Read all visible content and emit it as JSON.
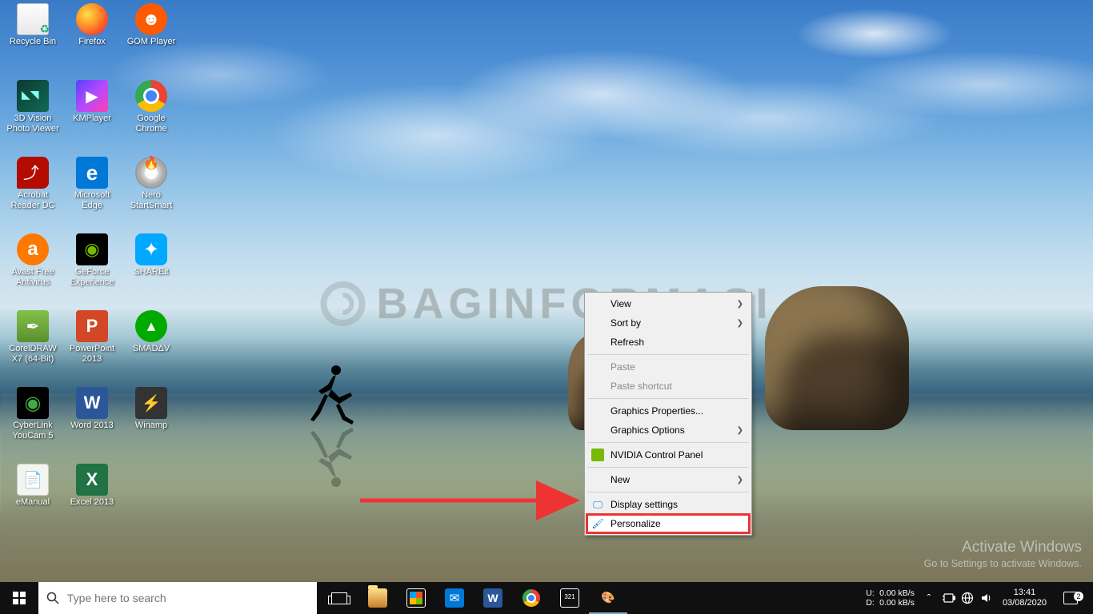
{
  "desktop_icons": [
    {
      "row": 0,
      "col": 0,
      "label": "Recycle Bin",
      "cls": "ic-recycle"
    },
    {
      "row": 0,
      "col": 1,
      "label": "Firefox",
      "cls": "ic-firefox"
    },
    {
      "row": 0,
      "col": 2,
      "label": "GOM Player",
      "cls": "ic-gom",
      "glyph": "☻"
    },
    {
      "row": 1,
      "col": 0,
      "label": "3D Vision Photo Viewer",
      "cls": "ic-3dvision"
    },
    {
      "row": 1,
      "col": 1,
      "label": "KMPlayer",
      "cls": "ic-kmp"
    },
    {
      "row": 1,
      "col": 2,
      "label": "Google Chrome",
      "cls": "ic-chrome"
    },
    {
      "row": 2,
      "col": 0,
      "label": "Acrobat Reader DC",
      "cls": "ic-acrobat"
    },
    {
      "row": 2,
      "col": 1,
      "label": "Microsoft Edge",
      "cls": "ic-edge"
    },
    {
      "row": 2,
      "col": 2,
      "label": "Nero StartSmart",
      "cls": "ic-nero"
    },
    {
      "row": 3,
      "col": 0,
      "label": "Avast Free Antivirus",
      "cls": "ic-avast"
    },
    {
      "row": 3,
      "col": 1,
      "label": "GeForce Experience",
      "cls": "ic-geforce"
    },
    {
      "row": 3,
      "col": 2,
      "label": "SHAREit",
      "cls": "ic-shareit"
    },
    {
      "row": 4,
      "col": 0,
      "label": "CorelDRAW X7 (64-Bit)",
      "cls": "ic-corel"
    },
    {
      "row": 4,
      "col": 1,
      "label": "PowerPoint 2013",
      "cls": "ic-ppt"
    },
    {
      "row": 4,
      "col": 2,
      "label": "SMADΔV",
      "cls": "ic-smadav"
    },
    {
      "row": 5,
      "col": 0,
      "label": "CyberLink YouCam 5",
      "cls": "ic-youcam"
    },
    {
      "row": 5,
      "col": 1,
      "label": "Word 2013",
      "cls": "ic-word"
    },
    {
      "row": 5,
      "col": 2,
      "label": "Winamp",
      "cls": "ic-winamp"
    },
    {
      "row": 6,
      "col": 0,
      "label": "eManual",
      "cls": "ic-emanual"
    },
    {
      "row": 6,
      "col": 1,
      "label": "Excel 2013",
      "cls": "ic-excel"
    }
  ],
  "context_menu": {
    "items": [
      {
        "label": "View",
        "has_sub": true
      },
      {
        "label": "Sort by",
        "has_sub": true
      },
      {
        "label": "Refresh"
      },
      {
        "sep": true
      },
      {
        "label": "Paste",
        "disabled": true
      },
      {
        "label": "Paste shortcut",
        "disabled": true
      },
      {
        "sep": true
      },
      {
        "label": "Graphics Properties..."
      },
      {
        "label": "Graphics Options",
        "has_sub": true
      },
      {
        "sep": true
      },
      {
        "label": "NVIDIA Control Panel",
        "icon": "nvidia"
      },
      {
        "sep": true
      },
      {
        "label": "New",
        "has_sub": true
      },
      {
        "sep": true
      },
      {
        "label": "Display settings",
        "icon": "display"
      },
      {
        "label": "Personalize",
        "icon": "personalize",
        "highlight": true
      }
    ]
  },
  "watermark_text": "BAGINFORMASI",
  "activate": {
    "line1": "Activate Windows",
    "line2": "Go to Settings to activate Windows."
  },
  "taskbar": {
    "search_placeholder": "Type here to search",
    "netspeed": {
      "up_label": "U:",
      "up_value": "0.00 kB/s",
      "down_label": "D:",
      "down_value": "0.00 kB/s"
    },
    "time": "13:41",
    "date": "03/08/2020",
    "action_center_count": "2"
  }
}
